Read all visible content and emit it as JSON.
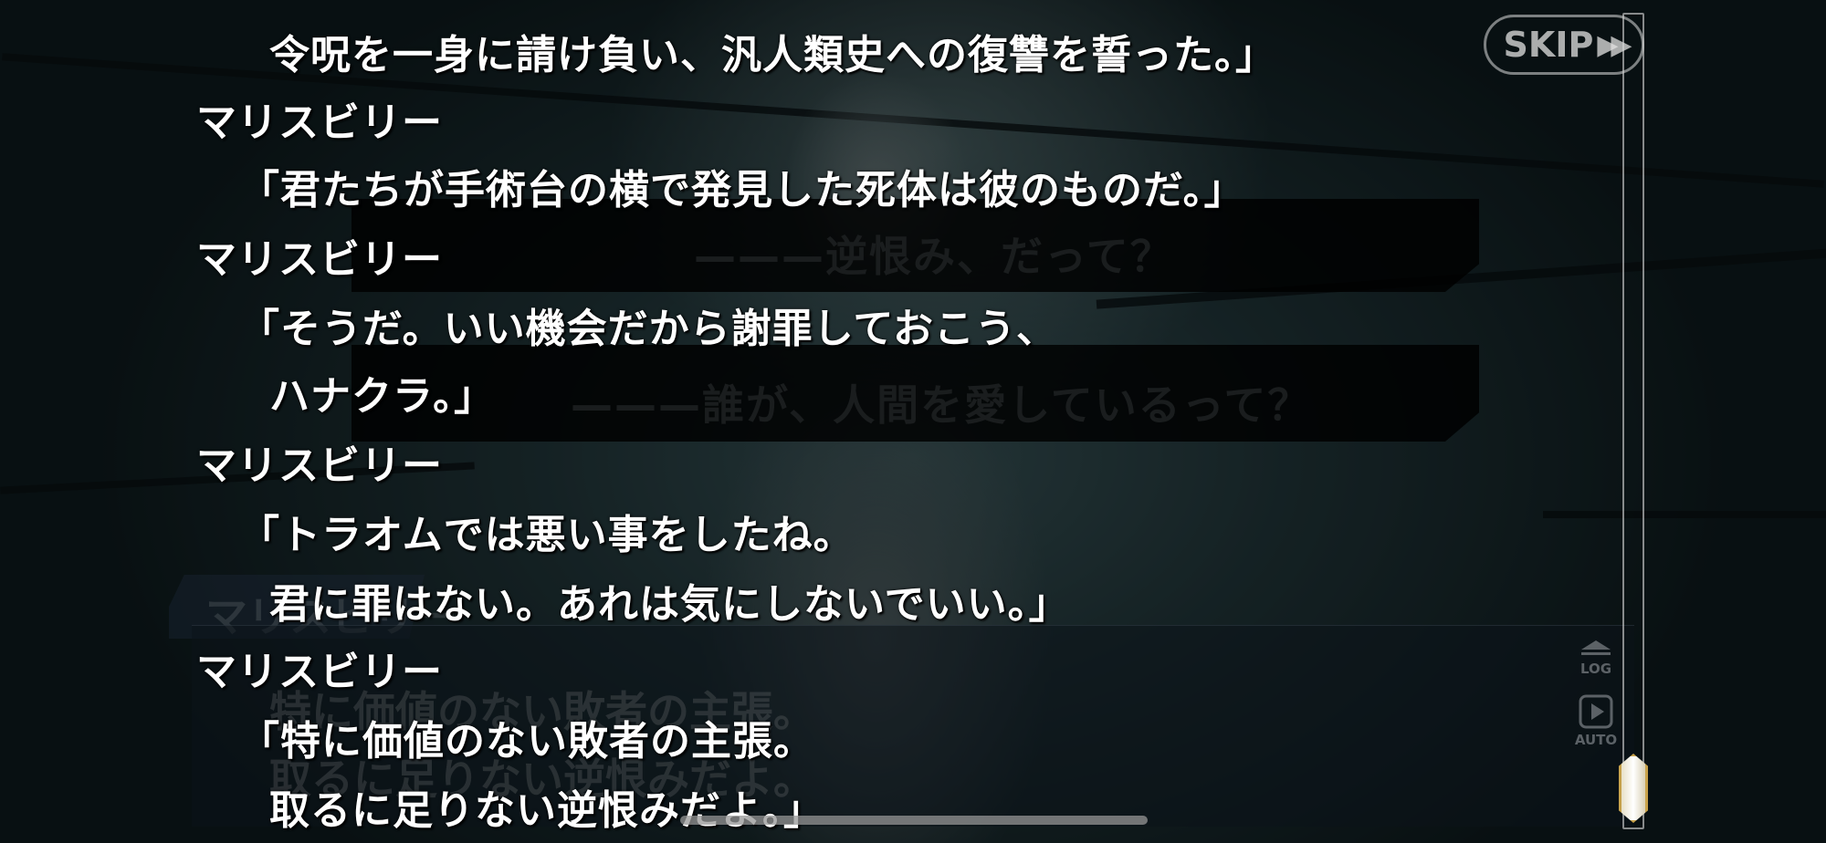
{
  "skip_button": {
    "label": "SKIP",
    "arrows": "▶▶"
  },
  "side_buttons": {
    "log_label": "LOG",
    "auto_label": "AUTO"
  },
  "background_lines": [
    {
      "text": "———逆恨み、だって？"
    },
    {
      "text": "———誰が、人間を愛しているって？"
    }
  ],
  "background_dialog": {
    "speaker": "マリスビリー",
    "line1": "特に価値のない敗者の主張。",
    "line2": "取るに足りない逆恨みだよ。"
  },
  "log_entries": [
    {
      "speaker": "",
      "lines": [
        "令呪を一身に請け負い、汎人類史への復讐を誓った。」"
      ]
    },
    {
      "speaker": "マリスビリー",
      "lines": [
        "「君たちが手術台の横で発見した死体は彼のものだ。」"
      ]
    },
    {
      "speaker": "マリスビリー",
      "lines": [
        "「そうだ。いい機会だから謝罪しておこう、",
        "ハナクラ。」"
      ]
    },
    {
      "speaker": "マリスビリー",
      "lines": [
        "「トラオムでは悪い事をしたね。",
        "君に罪はない。あれは気にしないでいい。」"
      ]
    },
    {
      "speaker": "マリスビリー",
      "lines": [
        "「特に価値のない敗者の主張。",
        "取るに足りない逆恨みだよ。」"
      ]
    }
  ],
  "colors": {
    "log_text": "#ffffff",
    "scroll_thumb_border": "#c8a24a",
    "overlay": "rgba(0,0,0,0.42)"
  }
}
